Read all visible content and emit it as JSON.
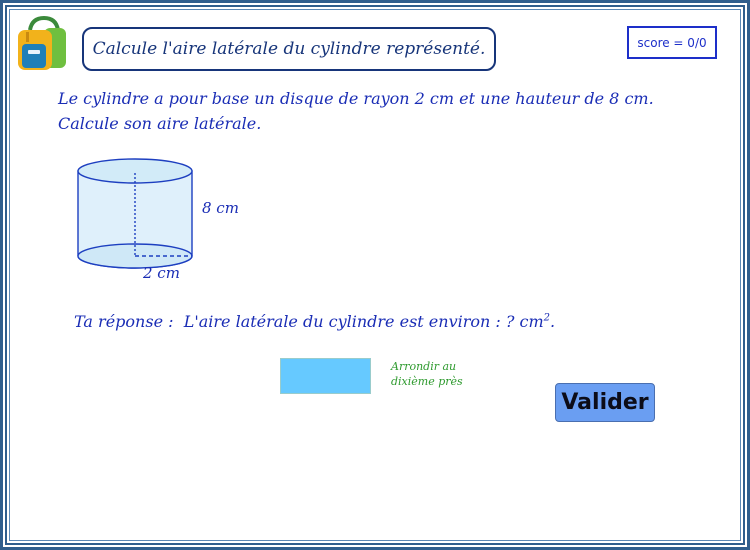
{
  "header": {
    "title": "Calcule l'aire latérale du cylindre représenté.",
    "score": "score = 0/0"
  },
  "problem": {
    "line1": "Le cylindre a pour base un disque de rayon 2 cm et une hauteur de 8 cm.",
    "line2": "Calcule son aire latérale."
  },
  "figure": {
    "height_label": "8 cm",
    "radius_label": "2 cm"
  },
  "answer": {
    "prefix": "Ta réponse :",
    "sentence": "L'aire latérale du cylindre est environ : ? cm",
    "exponent": "2",
    "suffix": ".",
    "input_value": "",
    "hint_line1": "Arrondir au",
    "hint_line2": "dixième près"
  },
  "actions": {
    "validate_label": "Valider"
  },
  "colors": {
    "frame": "#2f5d8c",
    "text": "#1a2db5",
    "input_bg": "#66c9ff",
    "button_bg": "#6a9ef2",
    "hint": "#2e9a2e"
  }
}
